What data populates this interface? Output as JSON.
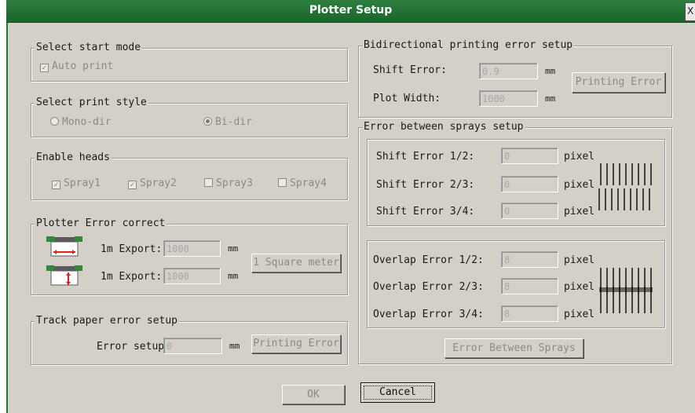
{
  "window": {
    "title": "Plotter Setup",
    "close_glyph": "X"
  },
  "start_mode": {
    "legend": "Select start mode",
    "auto_print": "Auto print",
    "auto_print_checked": true
  },
  "print_style": {
    "legend": "Select print style",
    "mono": "Mono-dir",
    "bi": "Bi-dir",
    "selected": "Bi-dir"
  },
  "heads": {
    "legend": "Enable heads",
    "items": [
      {
        "label": "Spray1",
        "checked": true
      },
      {
        "label": "Spray2",
        "checked": true
      },
      {
        "label": "Spray3",
        "checked": false
      },
      {
        "label": "Spray4",
        "checked": false
      }
    ]
  },
  "plotter_error": {
    "legend": "Plotter Error correct",
    "row1_label": "1m Export:",
    "row1_value": "1000",
    "row2_label": "1m Export:",
    "row2_value": "1000",
    "unit": "mm",
    "button": "1 Square meter"
  },
  "track_paper": {
    "legend": "Track paper error setup",
    "label": "Error setup:",
    "value": "0",
    "unit": "mm",
    "button": "Printing Error"
  },
  "bidirectional": {
    "legend": "Bidirectional printing error setup",
    "shift_label": "Shift Error:",
    "shift_value": "0.9",
    "shift_unit": "mm",
    "width_label": "Plot Width:",
    "width_value": "1000",
    "width_unit": "mm",
    "button": "Printing Error"
  },
  "sprays": {
    "legend": "Error between sprays setup",
    "shift": [
      {
        "label": "Shift Error 1/2:",
        "value": "0",
        "unit": "pixel"
      },
      {
        "label": "Shift Error 2/3:",
        "value": "0",
        "unit": "pixel"
      },
      {
        "label": "Shift Error 3/4:",
        "value": "0",
        "unit": "pixel"
      }
    ],
    "overlap": [
      {
        "label": "Overlap Error 1/2:",
        "value": "8",
        "unit": "pixel"
      },
      {
        "label": "Overlap Error 2/3:",
        "value": "8",
        "unit": "pixel"
      },
      {
        "label": "Overlap Error 3/4:",
        "value": "8",
        "unit": "pixel"
      }
    ],
    "button": "Error Between Sprays"
  },
  "footer": {
    "ok": "OK",
    "cancel": "Cancel"
  },
  "colors": {
    "titlebar": "#19652a",
    "dialog_bg": "#d4d0c8"
  }
}
